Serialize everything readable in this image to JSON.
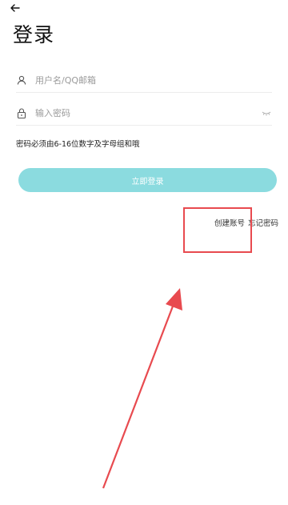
{
  "header": {
    "title": "登录",
    "back_icon": "back-arrow-icon"
  },
  "form": {
    "username_placeholder": "用户名/QQ邮箱",
    "password_placeholder": "输入密码",
    "hint": "密码必须由6-16位数字及字母组和哦",
    "login_label": "立即登录"
  },
  "links": {
    "create_account": "创建账号",
    "forgot_password": "忘记密码"
  },
  "colors": {
    "accent": "#8bdbdf",
    "annotation": "#e84a4f"
  }
}
